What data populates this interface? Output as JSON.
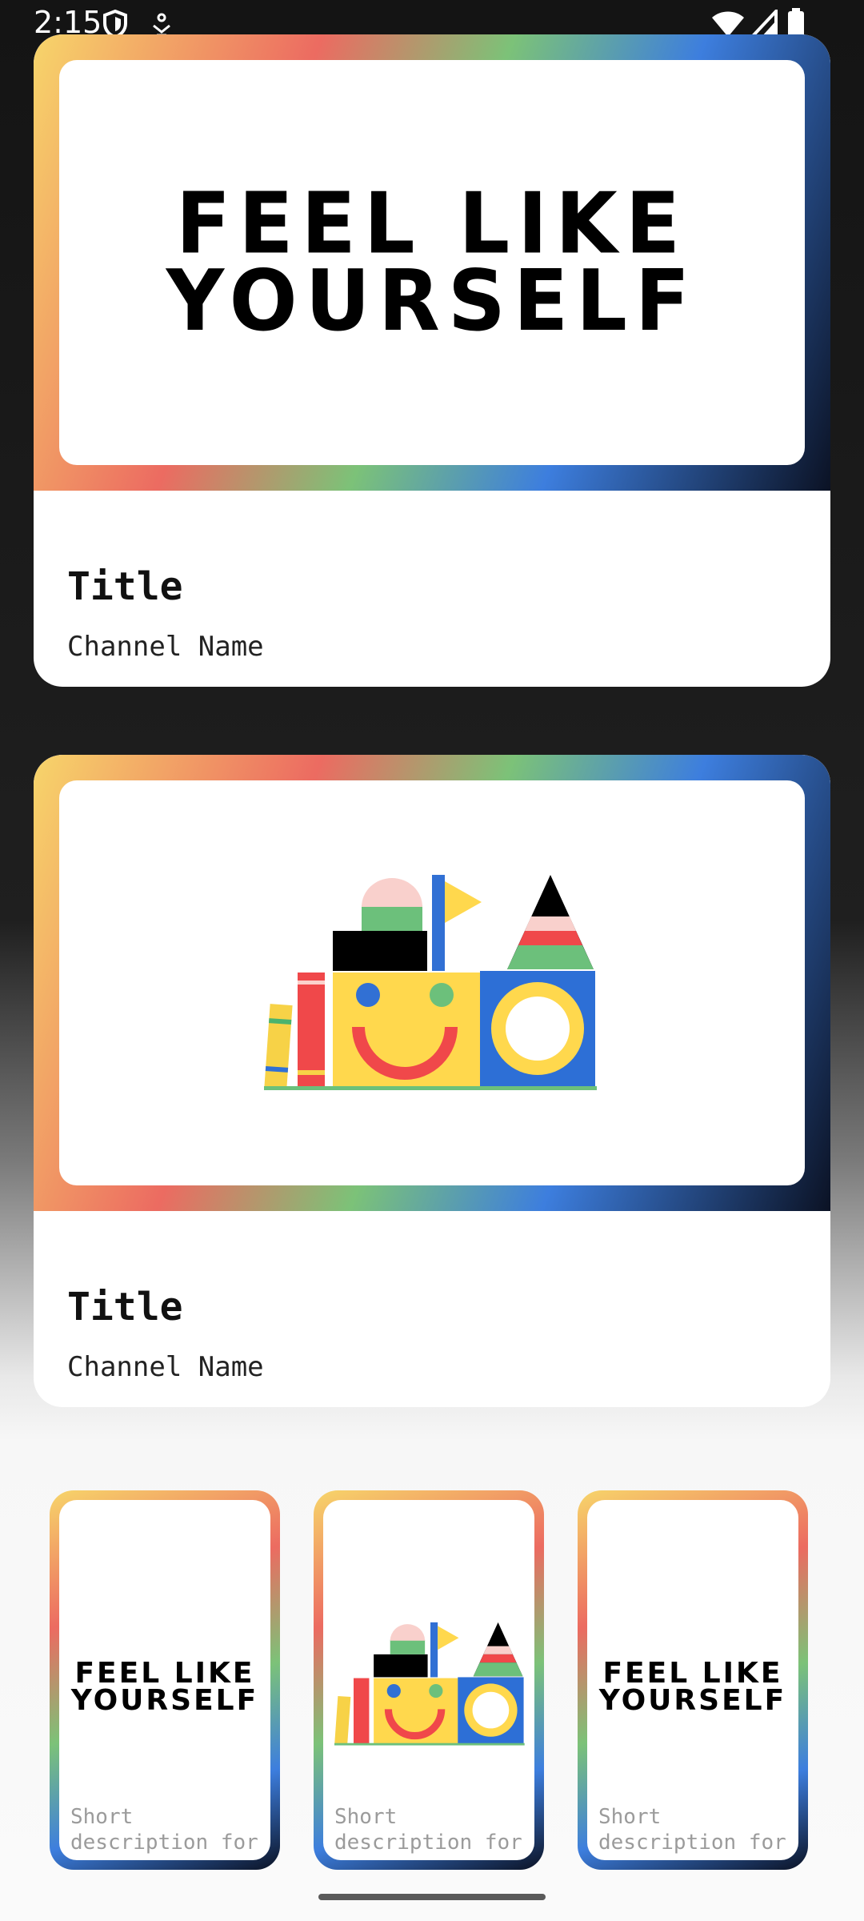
{
  "status_bar": {
    "time": "2:15",
    "left_icons": [
      "shield-icon",
      "notification-icon"
    ],
    "right_icons": [
      "wifi-icon",
      "signal-icon",
      "battery-icon"
    ]
  },
  "cards": [
    {
      "image_text_line1": "FEEL LIKE",
      "image_text_line2": "YOURSELF",
      "title": "Title",
      "channel": "Channel Name"
    },
    {
      "image": "toy-blocks-illustration",
      "title": "Title",
      "channel": "Channel Name"
    }
  ],
  "mini_cards": [
    {
      "image_text_line1": "FEEL LIKE",
      "image_text_line2": "YOURSELF",
      "description_line1": "Short",
      "description_line2": "description for"
    },
    {
      "image": "toy-blocks-illustration",
      "description_line1": "Short",
      "description_line2": "description for"
    },
    {
      "image_text_line1": "FEEL LIKE",
      "image_text_line2": "YOURSELF",
      "description_line1": "Short",
      "description_line2": "description for"
    }
  ],
  "colors": {
    "gradient": [
      "#f7d56a",
      "#ec6b61",
      "#7cc278",
      "#3d7ede",
      "#0b1224"
    ]
  }
}
